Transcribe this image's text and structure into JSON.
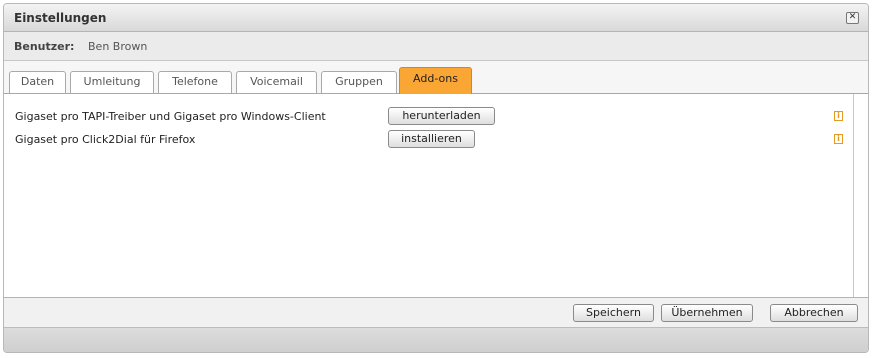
{
  "window": {
    "title": "Einstellungen",
    "close_glyph": "✕"
  },
  "user": {
    "label": "Benutzer:",
    "name": "Ben Brown"
  },
  "tabs": [
    {
      "label": "Daten",
      "active": false
    },
    {
      "label": "Umleitung",
      "active": false
    },
    {
      "label": "Telefone",
      "active": false
    },
    {
      "label": "Voicemail",
      "active": false
    },
    {
      "label": "Gruppen",
      "active": false
    },
    {
      "label": "Add-ons",
      "active": true
    }
  ],
  "addons": [
    {
      "label": "Gigaset pro TAPI-Treiber und Gigaset pro Windows-Client",
      "button": "herunterladen",
      "info_glyph": "i"
    },
    {
      "label": "Gigaset pro Click2Dial für Firefox",
      "button": "installieren",
      "info_glyph": "i"
    }
  ],
  "footer": {
    "save": "Speichern",
    "apply": "Übernehmen",
    "cancel": "Abbrechen"
  },
  "colors": {
    "active_tab": "#f9a634",
    "info_icon": "#e69a22"
  }
}
